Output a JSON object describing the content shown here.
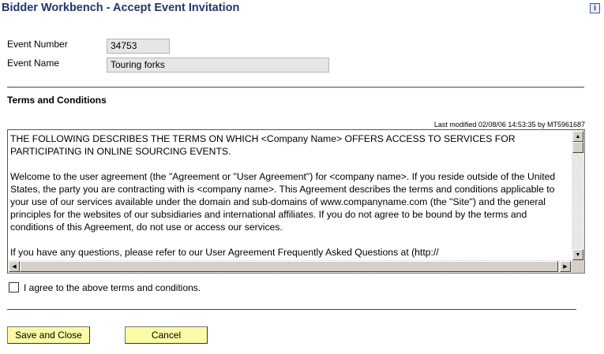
{
  "header": {
    "title": "Bidder Workbench - Accept Event Invitation",
    "help_icon": "help-info-icon"
  },
  "event": {
    "number_label": "Event Number",
    "number_value": "34753",
    "name_label": "Event Name",
    "name_value": "Touring forks"
  },
  "terms": {
    "heading": "Terms and Conditions",
    "last_modified": "Last modified 02/08/06 14:53:35 by MT5961687",
    "text": "THE FOLLOWING DESCRIBES THE TERMS ON WHICH <Company Name> OFFERS ACCESS TO SERVICES FOR PARTICIPATING IN ONLINE SOURCING EVENTS.\n\nWelcome to the user agreement (the \"Agreement or \"User Agreement\") for <company name>. If you reside outside of the United States, the party you are contracting with is <company name>. This Agreement describes the terms and conditions applicable to your use of our services available under the domain and sub-domains of www.companyname.com (the \"Site\") and the general principles for the websites of our subsidiaries and international affiliates. If you do not agree to be bound by the terms and conditions of this Agreement, do not use or access our services.\n\nIf you have any questions, please refer to our User Agreement Frequently Asked Questions at (http://"
  },
  "agree": {
    "label": "I agree to the above terms and conditions.",
    "checked": false
  },
  "buttons": {
    "save_close": "Save and Close",
    "cancel": "Cancel"
  },
  "colors": {
    "title": "#21376b",
    "button_bg": "#fbfba6",
    "divider": "#2f4a75",
    "readonly_bg": "#e6e6e6"
  }
}
